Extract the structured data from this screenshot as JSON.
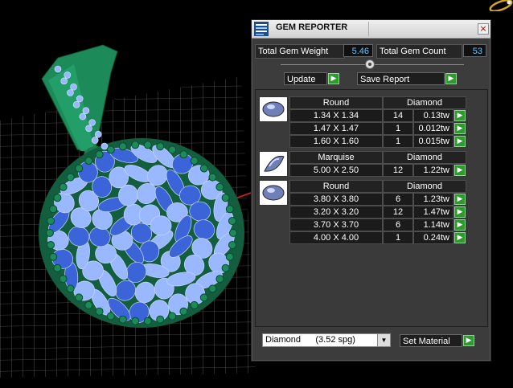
{
  "panel": {
    "title": "GEM REPORTER",
    "close_glyph": "×",
    "totals": {
      "weight_label": "Total Gem Weight",
      "weight_value": "5.46",
      "count_label": "Total Gem Count",
      "count_value": "53"
    },
    "slider": {
      "level": 0.5
    },
    "update_label": "Update",
    "save_report_label": "Save Report",
    "go_glyph": "▶",
    "groups": [
      {
        "shape": "Round",
        "material": "Diamond",
        "rows": [
          {
            "size": "1.34 X 1.34",
            "count": "14",
            "weight": "0.13tw"
          },
          {
            "size": "1.47 X 1.47",
            "count": "1",
            "weight": "0.012tw"
          },
          {
            "size": "1.60 X 1.60",
            "count": "1",
            "weight": "0.015tw"
          }
        ]
      },
      {
        "shape": "Marquise",
        "material": "Diamond",
        "rows": [
          {
            "size": "5.00 X 2.50",
            "count": "12",
            "weight": "1.22tw"
          }
        ]
      },
      {
        "shape": "Round",
        "material": "Diamond",
        "rows": [
          {
            "size": "3.80 X 3.80",
            "count": "6",
            "weight": "1.23tw"
          },
          {
            "size": "3.20 X 3.20",
            "count": "12",
            "weight": "1.47tw"
          },
          {
            "size": "3.70 X 3.70",
            "count": "6",
            "weight": "1.14tw"
          },
          {
            "size": "4.00 X 4.00",
            "count": "1",
            "weight": "0.24tw"
          }
        ]
      }
    ],
    "material_select": {
      "value": "Diamond      (3.52 spg)",
      "arrow": "▼"
    },
    "set_material_label": "Set Material"
  },
  "icons": {
    "app": "gem-reporter-icon",
    "round_gem": "round-gem-icon",
    "marquise_gem": "marquise-gem-icon",
    "ring": "ring-icon"
  },
  "colors": {
    "metal": "#1d8a5a",
    "gem_light": "#9ab8ff",
    "gem_dark": "#3a64d8",
    "value_text": "#6fc0ff",
    "go_button": "#2f9a2f"
  }
}
